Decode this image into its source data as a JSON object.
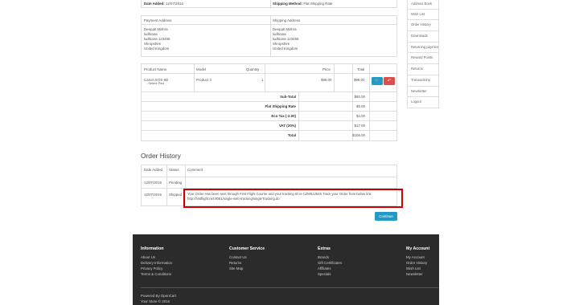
{
  "order": {
    "date_added_label": "Date Added:",
    "date_added": "12/07/2016",
    "shipping_method_label": "Shipping Method:",
    "shipping_method": "Flat Shipping Rate"
  },
  "addresses": {
    "payment_header": "Payment Address",
    "shipping_header": "Shipping Address",
    "payment_lines": [
      "Deepak Mishra",
      "ludhiana",
      "ludhiana 123456",
      "Shropshire",
      "United Kingdom"
    ],
    "shipping_lines": [
      "Deepak Mishra",
      "ludhiana",
      "ludhiana 123456",
      "Shropshire",
      "United Kingdom"
    ]
  },
  "products": {
    "headers": [
      "Product Name",
      "Model",
      "Quantity",
      "Price",
      "Total"
    ],
    "rows": [
      {
        "name": "Canon EOS 5D",
        "option": "- Select: Red",
        "model": "Product 3",
        "quantity": "1",
        "price": "$98.00",
        "total": "$98.00"
      }
    ],
    "totals": [
      {
        "label": "Sub-Total",
        "value": "$80.00"
      },
      {
        "label": "Flat Shipping Rate",
        "value": "$5.00"
      },
      {
        "label": "Eco Tax (-2.00)",
        "value": "$4.00"
      },
      {
        "label": "VAT (20%)",
        "value": "$17.00"
      },
      {
        "label": "Total",
        "value": "$106.00"
      }
    ],
    "reorder_icon": "cart-icon",
    "return_icon": "undo-icon"
  },
  "history": {
    "title": "Order History",
    "headers": [
      "Date Added",
      "Status",
      "Comment"
    ],
    "rows": [
      {
        "date": "12/07/2016",
        "status": "Pending",
        "comment": ""
      },
      {
        "date": "12/07/2016",
        "status": "Shipped",
        "comment_line1": "Your Order Has been sent through First Flight Courier and your tracking ID is CZW512545 Track your Order from below link",
        "comment_line2": "http://firstflight.net:8081/single-web-tracking/singleTracking.do"
      }
    ],
    "highlight_color": "#cc0000"
  },
  "continue_label": "Continue",
  "sidebar": {
    "items": [
      "Address Book",
      "Wish List",
      "Order History",
      "Downloads",
      "Returning payments",
      "Reward Points",
      "Returns",
      "Transactions",
      "Newsletter",
      "Logout"
    ]
  },
  "footer": {
    "columns": [
      {
        "title": "Information",
        "links": [
          "About Us",
          "Delivery Information",
          "Privacy Policy",
          "Terms & Conditions"
        ]
      },
      {
        "title": "Customer Service",
        "links": [
          "Contact Us",
          "Returns",
          "Site Map"
        ]
      },
      {
        "title": "Extras",
        "links": [
          "Brands",
          "Gift Certificates",
          "Affiliates",
          "Specials"
        ]
      },
      {
        "title": "My Account",
        "links": [
          "My Account",
          "Order History",
          "Wish List",
          "Newsletter"
        ]
      }
    ],
    "powered": "Powered By OpenCart",
    "copyright": "Your Store © 2016"
  },
  "colors": {
    "primary": "#229ac8",
    "danger": "#da4f49",
    "footer_bg": "#2b2b2b"
  }
}
